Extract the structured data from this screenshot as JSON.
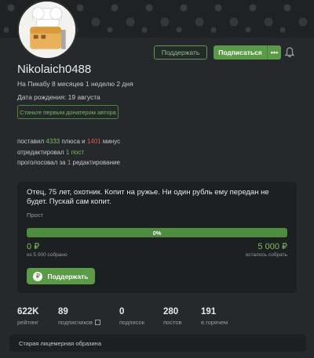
{
  "profile": {
    "username": "Nikolaich0488",
    "member_since": "На Пикабу 8 месяцев 1 неделю 2 дня",
    "birthday": "Дата рождения: 19 августа",
    "donor_cta": "Станьте первым донатером автора"
  },
  "actions": {
    "support_label": "Поддержать",
    "subscribe_label": "Подписаться",
    "more_label": "•••"
  },
  "stats": {
    "votes_prefix": "поставил ",
    "plus_count": "4333",
    "plus_label": " плюса и ",
    "minus_count": "1401",
    "minus_label": " минус",
    "edited_prefix": "отредактировал ",
    "edited_value": "1 пост",
    "voted_prefix": "проголосовал за ",
    "voted_value": "1",
    "voted_suffix": " редактирование"
  },
  "fundraiser": {
    "title": "Отец, 75 лет, охотник. Копит на ружье. Ни один рубль ему передан не будет. Пускай сам копит.",
    "subtitle": "Прост",
    "progress_label": "0%",
    "progress_percent": 0,
    "collected": "0 ₽",
    "collected_caption": "из 5 000 собрано",
    "remaining": "5 000 ₽",
    "remaining_caption": "осталось собрать",
    "donate_label": "Поддержать",
    "donate_icon": "₽"
  },
  "counters": [
    {
      "value": "622K",
      "label": "рейтинг"
    },
    {
      "value": "89",
      "label": "подписчиков"
    },
    {
      "value": "0",
      "label": "подписок"
    },
    {
      "value": "280",
      "label": "постов"
    },
    {
      "value": "191",
      "label": "в горячем"
    }
  ],
  "footer": {
    "text": "Старая лицемерная образина"
  },
  "colors": {
    "accent": "#5b9a47",
    "minus": "#e05a4e",
    "background": "#26292b"
  }
}
